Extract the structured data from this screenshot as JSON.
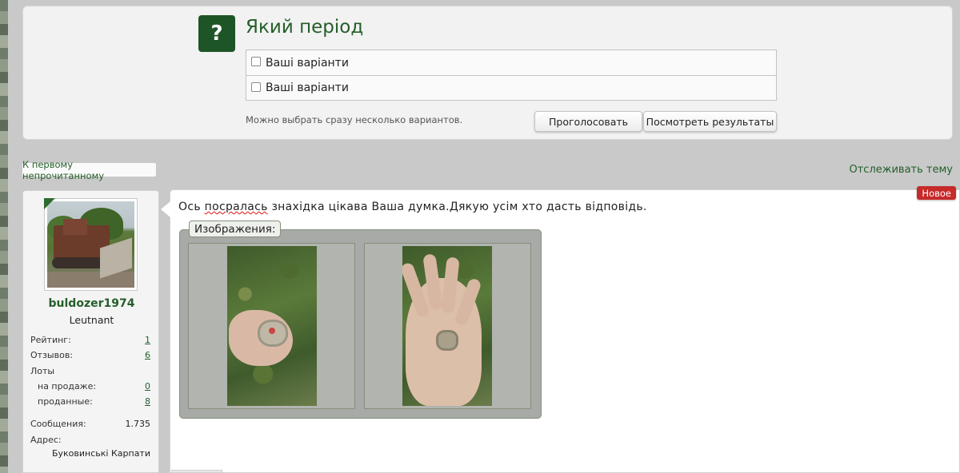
{
  "poll": {
    "title": "Який період",
    "options": [
      "Ваші варіанти",
      "Ваші варіанти"
    ],
    "hint": "Можно выбрать сразу несколько вариантов.",
    "vote_label": "Проголосовать",
    "results_label": "Посмотреть результаты"
  },
  "thread": {
    "unread_link": "К первому непрочитанному",
    "watch_link": "Отслеживать тему"
  },
  "user": {
    "name": "buldozer1974",
    "rank": "Leutnant",
    "stats": {
      "rating_label": "Рейтинг:",
      "rating": "1",
      "reviews_label": "Отзывов:",
      "reviews": "6",
      "lots_label": "Лоты",
      "for_sale_label": "на продаже:",
      "for_sale": "0",
      "sold_label": "проданные:",
      "sold": "8",
      "messages_label": "Сообщения:",
      "messages": "1.735",
      "address_label": "Адрес:",
      "address": "Буковинські Карпати"
    }
  },
  "post": {
    "badge_new": "Новое",
    "text_before": "Ось ",
    "text_misspelled": "посралась",
    "text_after": " знахідка цікава Ваша думка.Дякую усім хто дасть відповідь.",
    "attachments_legend": "Изображения:"
  },
  "colors": {
    "accent_green": "#245e2a",
    "badge_red": "#c72a2a",
    "page_bg": "#c9c9c9"
  }
}
